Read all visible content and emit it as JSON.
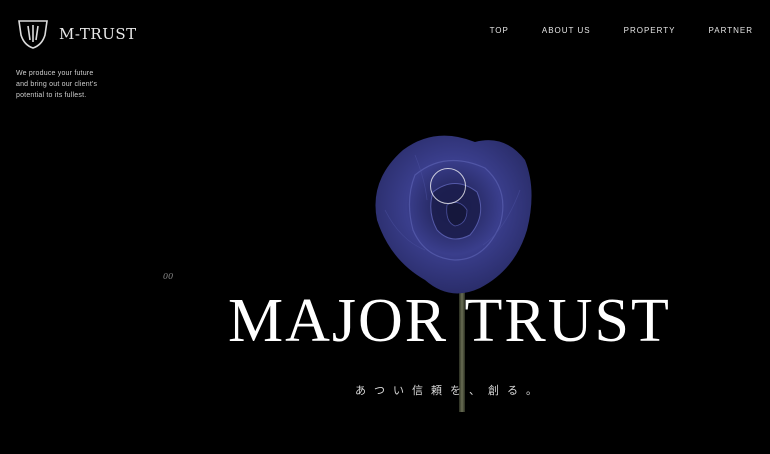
{
  "brand": {
    "name": "M-TRUST",
    "logo_icon": "shield-crest-icon"
  },
  "nav": {
    "items": [
      {
        "label": "TOP"
      },
      {
        "label": "ABOUT US"
      },
      {
        "label": "PROPERTY"
      },
      {
        "label": "PARTNER"
      }
    ]
  },
  "hero": {
    "tagline": "We produce your future\nand bring out our client's\npotential to its fullest.",
    "index": "00",
    "headline": "MAJOR TRUST",
    "subheadline": "あつい信頼を、創る。",
    "image": "blue-rose",
    "accent_color": "#3b3f8f"
  }
}
